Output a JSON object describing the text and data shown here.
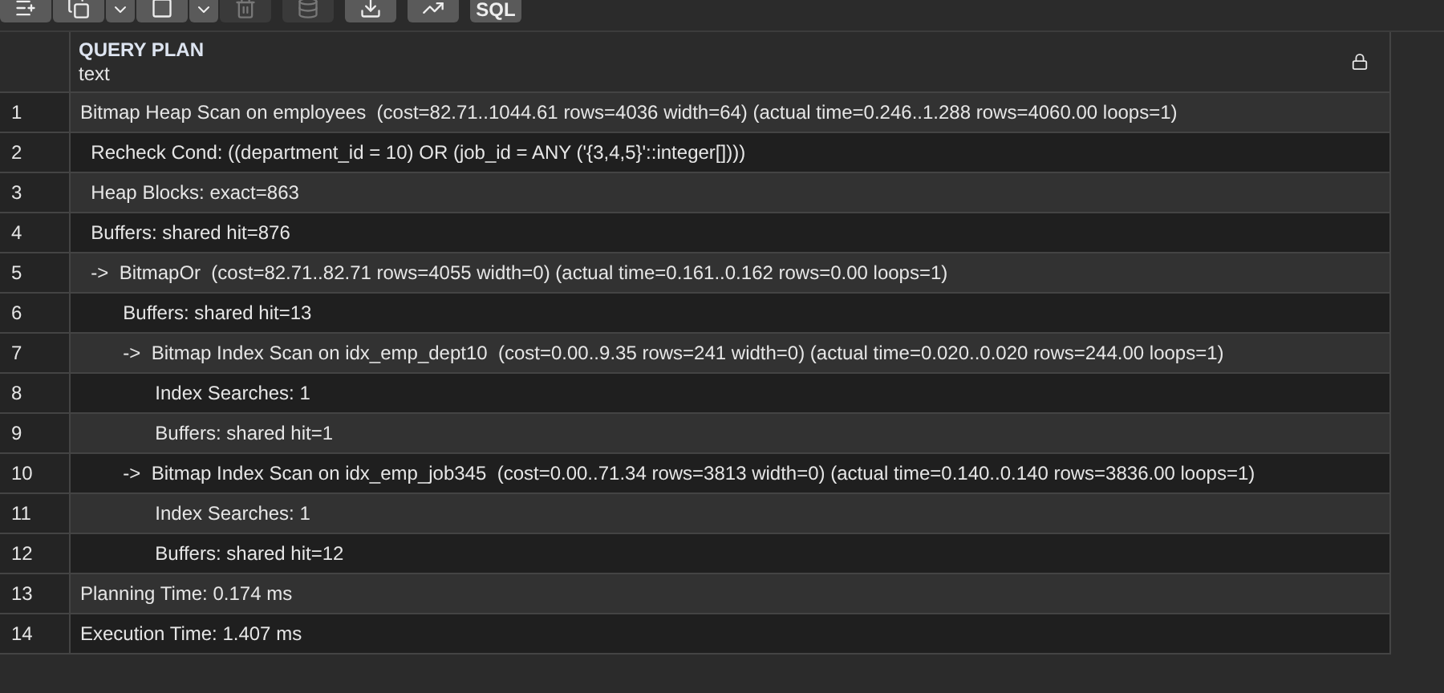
{
  "toolbar": [
    {
      "kind": "add-row",
      "disabled": false
    },
    {
      "kind": "copy",
      "disabled": false
    },
    {
      "kind": "dropdown",
      "disabled": false
    },
    {
      "kind": "paste",
      "disabled": false
    },
    {
      "kind": "dropdown",
      "disabled": false
    },
    {
      "kind": "delete",
      "disabled": true
    },
    {
      "kind": "save",
      "disabled": true
    },
    {
      "kind": "download",
      "disabled": false
    },
    {
      "kind": "graph",
      "disabled": false
    },
    {
      "kind": "sql",
      "label": "SQL",
      "disabled": false
    }
  ],
  "table": {
    "columns": [
      {
        "name": "QUERY PLAN",
        "type": "text",
        "locked": true
      }
    ],
    "rows": [
      {
        "number": "1",
        "text": "Bitmap Heap Scan on employees  (cost=82.71..1044.61 rows=4036 width=64) (actual time=0.246..1.288 rows=4060.00 loops=1)"
      },
      {
        "number": "2",
        "text": "  Recheck Cond: ((department_id = 10) OR (job_id = ANY ('{3,4,5}'::integer[])))"
      },
      {
        "number": "3",
        "text": "  Heap Blocks: exact=863"
      },
      {
        "number": "4",
        "text": "  Buffers: shared hit=876"
      },
      {
        "number": "5",
        "text": "  ->  BitmapOr  (cost=82.71..82.71 rows=4055 width=0) (actual time=0.161..0.162 rows=0.00 loops=1)"
      },
      {
        "number": "6",
        "text": "        Buffers: shared hit=13"
      },
      {
        "number": "7",
        "text": "        ->  Bitmap Index Scan on idx_emp_dept10  (cost=0.00..9.35 rows=241 width=0) (actual time=0.020..0.020 rows=244.00 loops=1)"
      },
      {
        "number": "8",
        "text": "              Index Searches: 1"
      },
      {
        "number": "9",
        "text": "              Buffers: shared hit=1"
      },
      {
        "number": "10",
        "text": "        ->  Bitmap Index Scan on idx_emp_job345  (cost=0.00..71.34 rows=3813 width=0) (actual time=0.140..0.140 rows=3836.00 loops=1)"
      },
      {
        "number": "11",
        "text": "              Index Searches: 1"
      },
      {
        "number": "12",
        "text": "              Buffers: shared hit=12"
      },
      {
        "number": "13",
        "text": "Planning Time: 0.174 ms"
      },
      {
        "number": "14",
        "text": "Execution Time: 1.407 ms"
      }
    ]
  }
}
